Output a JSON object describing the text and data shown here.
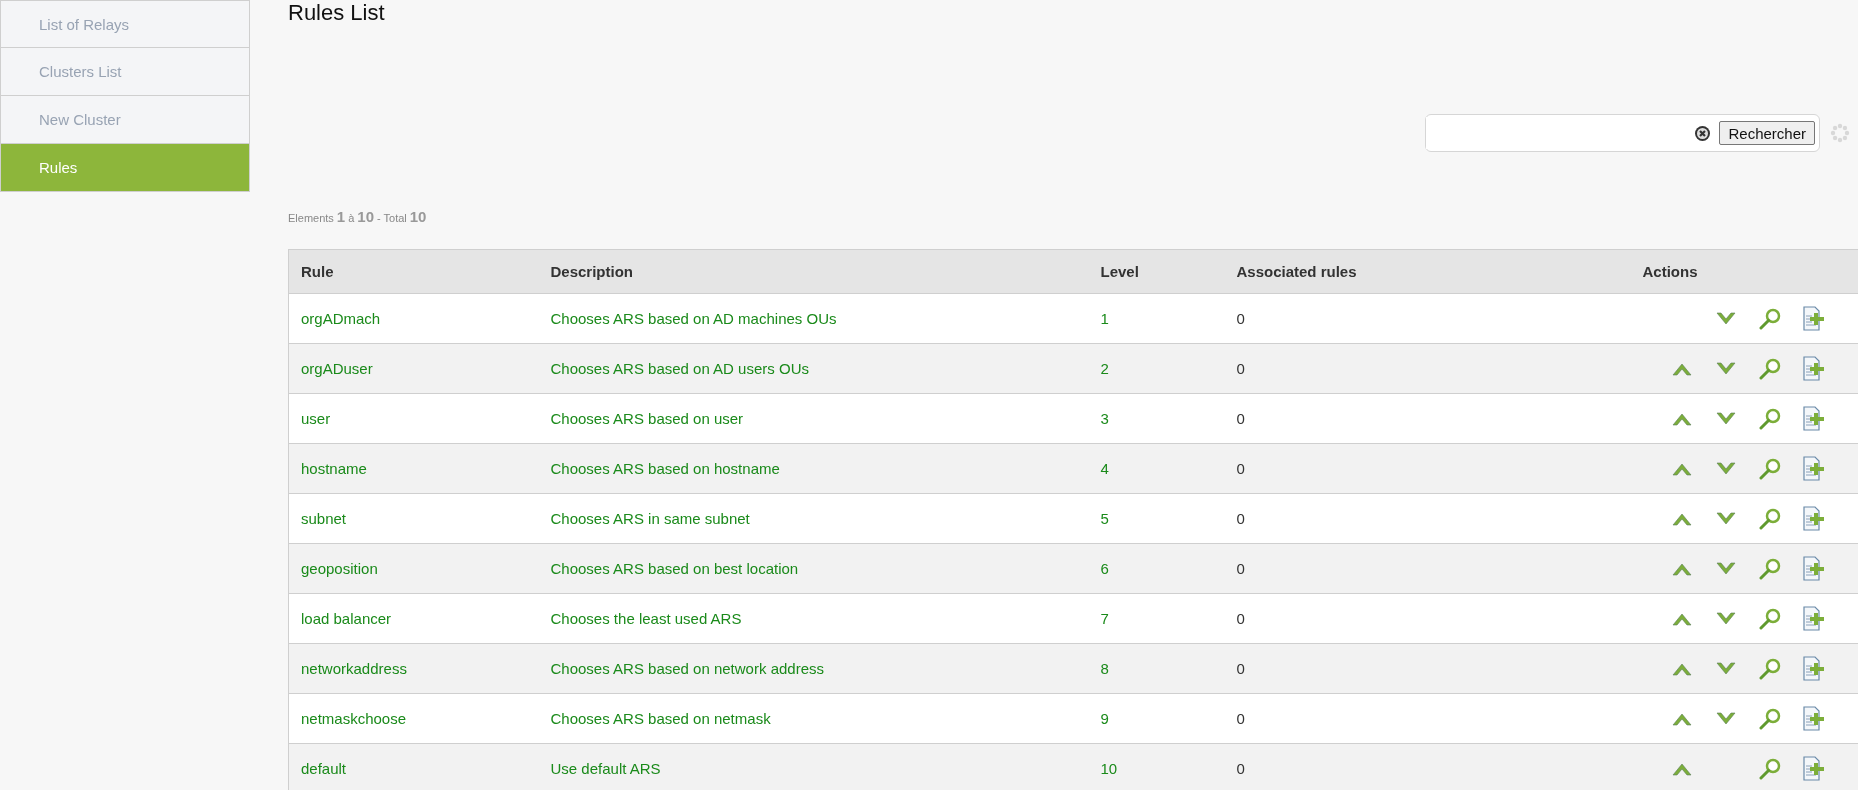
{
  "sidebar": {
    "items": [
      {
        "label": "List of Relays",
        "selected": false
      },
      {
        "label": "Clusters List",
        "selected": false
      },
      {
        "label": "New Cluster",
        "selected": false
      },
      {
        "label": "Rules",
        "selected": true
      }
    ]
  },
  "page_title": "Rules List",
  "search": {
    "button": "Rechercher"
  },
  "pagination": {
    "label": "Elements",
    "from": "1",
    "sep": "à",
    "to": "10",
    "total_label": "- Total",
    "total": "10"
  },
  "table": {
    "columns": [
      "Rule",
      "Description",
      "Level",
      "Associated rules",
      "Actions"
    ],
    "rows": [
      {
        "rule": "orgADmach",
        "description": "Chooses ARS based on AD machines OUs",
        "level": "1",
        "associated": "0",
        "can_move_up": false,
        "can_move_down": true
      },
      {
        "rule": "orgADuser",
        "description": "Chooses ARS based on AD users OUs",
        "level": "2",
        "associated": "0",
        "can_move_up": true,
        "can_move_down": true
      },
      {
        "rule": "user",
        "description": "Chooses ARS based on user",
        "level": "3",
        "associated": "0",
        "can_move_up": true,
        "can_move_down": true
      },
      {
        "rule": "hostname",
        "description": "Chooses ARS based on hostname",
        "level": "4",
        "associated": "0",
        "can_move_up": true,
        "can_move_down": true
      },
      {
        "rule": "subnet",
        "description": "Chooses ARS in same subnet",
        "level": "5",
        "associated": "0",
        "can_move_up": true,
        "can_move_down": true
      },
      {
        "rule": "geoposition",
        "description": "Chooses ARS based on best location",
        "level": "6",
        "associated": "0",
        "can_move_up": true,
        "can_move_down": true
      },
      {
        "rule": "load balancer",
        "description": "Chooses the least used ARS",
        "level": "7",
        "associated": "0",
        "can_move_up": true,
        "can_move_down": true
      },
      {
        "rule": "networkaddress",
        "description": "Chooses ARS based on network address",
        "level": "8",
        "associated": "0",
        "can_move_up": true,
        "can_move_down": true
      },
      {
        "rule": "netmaskchoose",
        "description": "Chooses ARS based on netmask",
        "level": "9",
        "associated": "0",
        "can_move_up": true,
        "can_move_down": true
      },
      {
        "rule": "default",
        "description": "Use default ARS",
        "level": "10",
        "associated": "0",
        "can_move_up": true,
        "can_move_down": false
      }
    ]
  }
}
